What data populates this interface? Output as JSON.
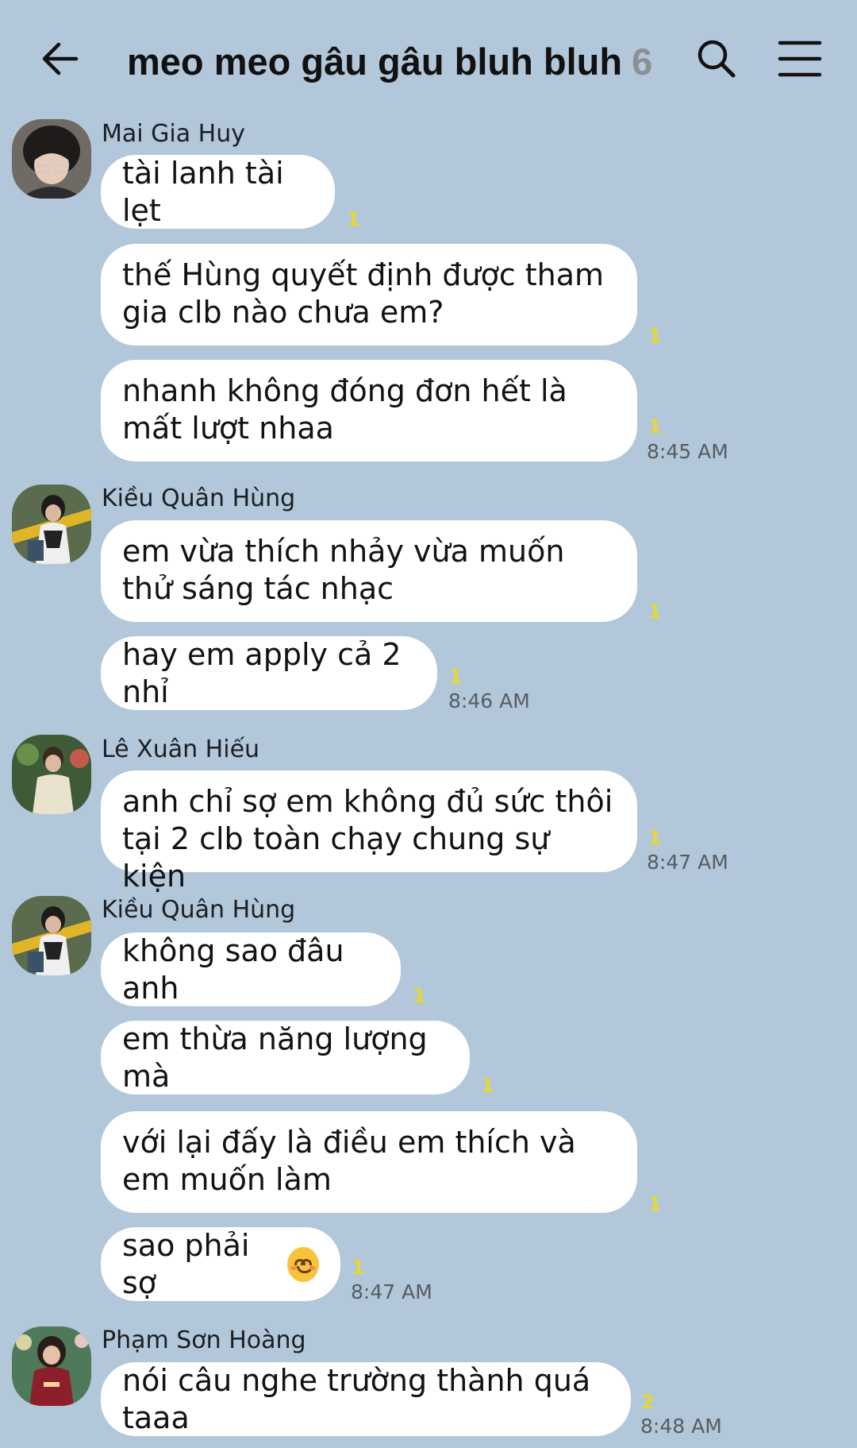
{
  "header": {
    "title": "meo meo gâu gâu bluh bluh",
    "member_count": "6"
  },
  "messages": [
    {
      "sender": "Mai Gia Huy",
      "bubbles": [
        {
          "text": "tài lanh tài lẹt",
          "unread": "1"
        },
        {
          "text": "thế Hùng quyết định được tham gia clb nào chưa em?",
          "unread": "1"
        },
        {
          "text": "nhanh không đóng đơn hết là mất lượt nhaa",
          "unread": "1",
          "time": "8:45 AM"
        }
      ]
    },
    {
      "sender": "Kiều Quân Hùng",
      "bubbles": [
        {
          "text": "em vừa thích nhảy vừa muốn thử sáng tác nhạc",
          "unread": "1"
        },
        {
          "text": "hay em apply cả 2 nhỉ",
          "unread": "1",
          "time": "8:46 AM"
        }
      ]
    },
    {
      "sender": "Lê Xuân Hiếu",
      "bubbles": [
        {
          "text": "anh chỉ sợ em không đủ sức thôi tại 2 clb toàn chạy chung sự kiện",
          "unread": "1",
          "time": "8:47 AM"
        }
      ]
    },
    {
      "sender": "Kiều Quân Hùng",
      "bubbles": [
        {
          "text": "không sao đâu anh",
          "unread": "1"
        },
        {
          "text": "em thừa năng lượng mà",
          "unread": "1"
        },
        {
          "text": "với lại đấy là điều em thích và em muốn làm",
          "unread": "1"
        },
        {
          "text": "sao phải sợ",
          "emoji": "smiling-face",
          "unread": "1",
          "time": "8:47 AM"
        }
      ]
    },
    {
      "sender": "Phạm Sơn Hoàng",
      "bubbles": [
        {
          "text": "nói câu nghe trường thành quá taaa",
          "unread": "2",
          "time": "8:48 AM"
        }
      ]
    }
  ],
  "icons": {
    "back": "arrow-left-icon",
    "search": "search-icon",
    "menu": "hamburger-menu-icon"
  },
  "colors": {
    "background": "#b2c7da",
    "bubble": "#ffffff",
    "unread": "#e7d730"
  }
}
